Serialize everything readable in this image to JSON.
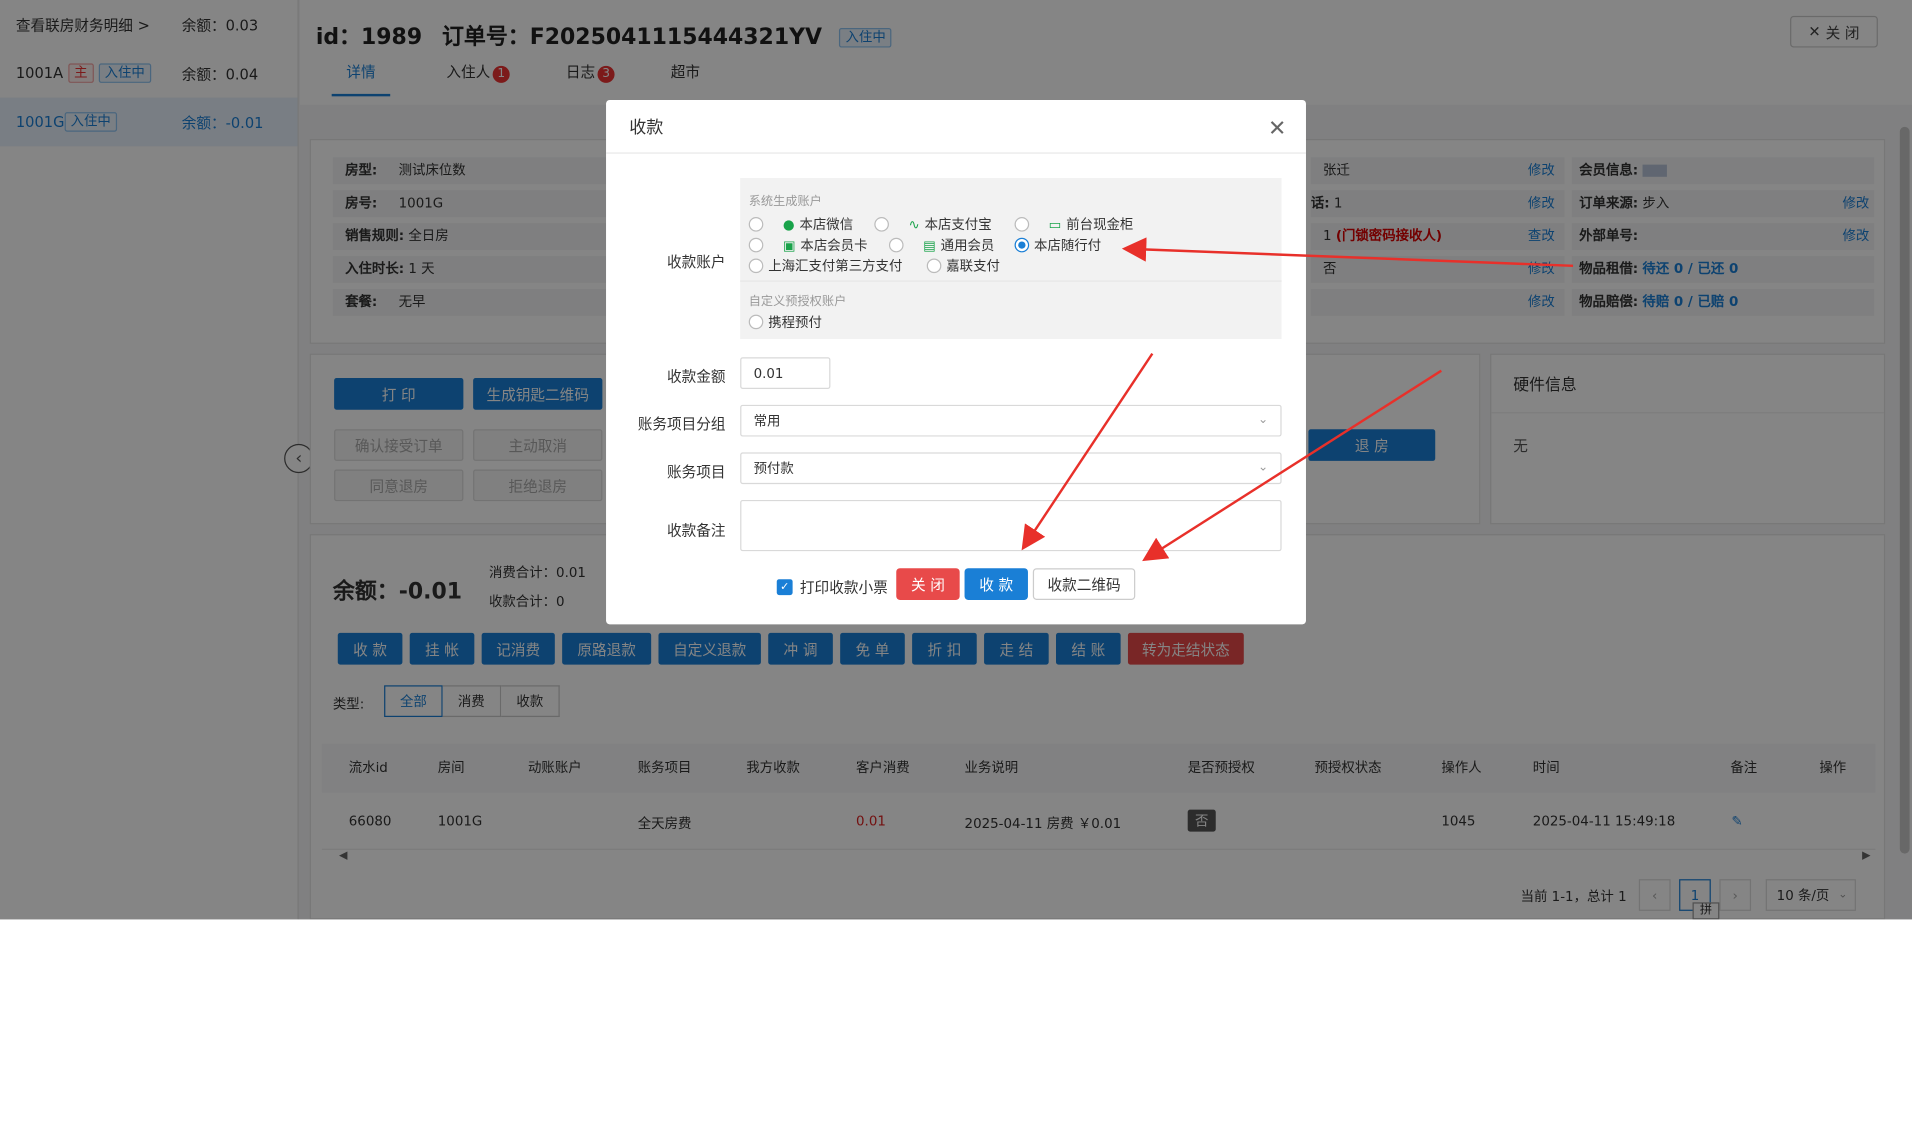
{
  "sidebar": {
    "view_link": "查看联房财务明细 >",
    "rows": [
      {
        "room": "",
        "tags": [],
        "balance": "余额：0.03"
      },
      {
        "room": "1001A",
        "tag_main": "主",
        "tag_status": "入住中",
        "balance": "余额：0.04"
      },
      {
        "room": "1001G",
        "tag_status": "入住中",
        "balance": "余额：-0.01"
      }
    ]
  },
  "header": {
    "id_label": "id：1989",
    "order_label": "订单号：F2025041115444321YV",
    "status": "入住中",
    "close": "关 闭",
    "tabs": [
      {
        "label": "详情",
        "badge": ""
      },
      {
        "label": "入住人",
        "badge": "1"
      },
      {
        "label": "日志",
        "badge": "3"
      },
      {
        "label": "超市",
        "badge": ""
      }
    ]
  },
  "info": {
    "left": [
      {
        "k": "房型:",
        "v": "测试床位数"
      },
      {
        "k": "房号:",
        "v": "1001G"
      },
      {
        "k": "销售规则:",
        "v": "全日房"
      },
      {
        "k": "入住时长:",
        "v": "1 天"
      },
      {
        "k": "套餐:",
        "v": "无早"
      }
    ],
    "mid": [
      {
        "v": "张迁",
        "action": "修改"
      },
      {
        "prefix": "话:",
        "v": "1",
        "action": "修改"
      },
      {
        "v": "1",
        "extra": "(门锁密码接收人)",
        "action": "查改"
      },
      {
        "v": "否",
        "action": "修改"
      },
      {
        "v": "",
        "action": "修改"
      }
    ],
    "right": [
      {
        "k": "会员信息:",
        "v": "",
        "action": ""
      },
      {
        "k": "订单来源:",
        "v": "步入",
        "action": "修改"
      },
      {
        "k": "外部单号:",
        "v": "",
        "action": "修改"
      },
      {
        "k": "物品租借:",
        "v": "待还 0 / 已还 0",
        "action": ""
      },
      {
        "k": "物品赔偿:",
        "v": "待赔 0 / 已赔 0",
        "action": ""
      }
    ]
  },
  "actions": {
    "print": "打 印",
    "gen_key": "生成钥匙二维码",
    "confirm": "确认接受订单",
    "cancel": "主动取消",
    "agree_refund": "同意退房",
    "reject_refund": "拒绝退房",
    "checkout": "退 房"
  },
  "hardware": {
    "title": "硬件信息",
    "value": "无"
  },
  "balance": {
    "label": "余额：-0.01",
    "consume": "消费合计：0.01",
    "receive": "收款合计：0"
  },
  "ops": [
    "收 款",
    "挂 帐",
    "记消费",
    "原路退款",
    "自定义退款",
    "冲 调",
    "免 单",
    "折 扣",
    "走 结",
    "结 账",
    "转为走结状态"
  ],
  "filter": {
    "label": "类型:",
    "options": [
      "全部",
      "消费",
      "收款"
    ]
  },
  "table": {
    "headers": [
      "流水id",
      "房间",
      "动账账户",
      "账务项目",
      "我方收款",
      "客户消费",
      "业务说明",
      "是否预授权",
      "预授权状态",
      "操作人",
      "时间",
      "备注",
      "操作"
    ],
    "rows": [
      {
        "id": "66080",
        "room": "1001G",
        "account": "",
        "item": "全天房费",
        "recv": "",
        "consume": "0.01",
        "desc": "2025-04-11 房费 ￥0.01",
        "preauth": "否",
        "preauth_state": "",
        "operator": "1045",
        "time": "2025-04-11 15:49:18"
      }
    ]
  },
  "pagination": {
    "summary": "当前 1-1，总计 1",
    "page": "1",
    "size": "10 条/页"
  },
  "ime": "拼",
  "modal": {
    "title": "收款",
    "account_label": "收款账户",
    "sys_group": "系统生成账户",
    "options": [
      "本店微信",
      "本店支付宝",
      "前台现金柜",
      "本店会员卡",
      "通用会员",
      "本店随行付",
      "上海汇支付第三方支付",
      "嘉联支付"
    ],
    "selected": "本店随行付",
    "custom_group": "自定义预授权账户",
    "custom_options": [
      "携程预付"
    ],
    "amount_label": "收款金额",
    "amount": "0.01",
    "group_label": "账务项目分组",
    "group_value": "常用",
    "item_label": "账务项目",
    "item_value": "预付款",
    "remark_label": "收款备注",
    "print_receipt": "打印收款小票",
    "btn_close": "关 闭",
    "btn_receive": "收 款",
    "btn_qr": "收款二维码"
  },
  "colors": {
    "primary": "#1a7fd6",
    "danger": "#e84a4a",
    "arrow": "#e8302a"
  }
}
